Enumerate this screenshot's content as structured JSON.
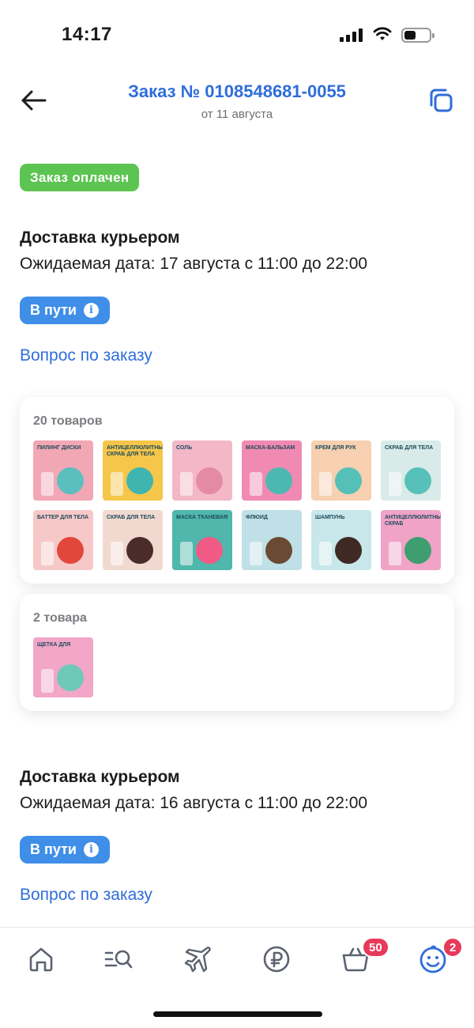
{
  "status_bar": {
    "time": "14:17",
    "battery_level": 0.45
  },
  "header": {
    "title": "Заказ № 0108548681-0055",
    "subtitle": "от 11 августа"
  },
  "order_status": "Заказ оплачен",
  "shipments": [
    {
      "title": "Доставка курьером",
      "expected": "Ожидаемая дата: 17 августа с 11:00 до 22:00",
      "status": "В пути",
      "question": "Вопрос по заказу"
    },
    {
      "title": "Доставка курьером",
      "expected": "Ожидаемая дата: 16 августа с 11:00 до 22:00",
      "status": "В пути",
      "question": "Вопрос по заказу"
    }
  ],
  "groups": [
    {
      "count": "20 товаров",
      "items": [
        {
          "label": "Пилинг диски",
          "bg": "#f2a7b5",
          "accent": "#5bbfbf"
        },
        {
          "label": "Антицеллюлитный скраб для тела",
          "bg": "#f5c64a",
          "accent": "#3fb5b0"
        },
        {
          "label": "Соль",
          "bg": "#f3b7c8",
          "accent": "#e58aa5"
        },
        {
          "label": "Маска-бальзам",
          "bg": "#f08ab3",
          "accent": "#4db8b2"
        },
        {
          "label": "Крем для рук",
          "bg": "#f6d0b0",
          "accent": "#55c0b7"
        },
        {
          "label": "Скраб для тела",
          "bg": "#d8ebe8",
          "accent": "#57c1b9"
        },
        {
          "label": "Баттер для тела",
          "bg": "#f7c8c8",
          "accent": "#e2473b"
        },
        {
          "label": "Скраб для тела",
          "bg": "#f1d9cf",
          "accent": "#4a2d2a"
        },
        {
          "label": "Маска тканевая",
          "bg": "#4fb7ac",
          "accent": "#f05b86"
        },
        {
          "label": "Флюид",
          "bg": "#bfe0e6",
          "accent": "#6b4a34"
        },
        {
          "label": "Шампунь",
          "bg": "#c7e7ea",
          "accent": "#3e2a22"
        },
        {
          "label": "Антицеллюлитный скраб",
          "bg": "#f0a3c7",
          "accent": "#3e9e6f"
        }
      ]
    },
    {
      "count": "2 товара",
      "items": [
        {
          "label": "Щетка для",
          "bg": "#f2a6c8",
          "accent": "#6fc9b9"
        }
      ]
    }
  ],
  "nav": {
    "cart_count": "50",
    "profile_count": "2"
  },
  "colors": {
    "accent_blue": "#2f6ddb",
    "paid_green": "#5cc451",
    "transit_blue": "#3f8ee8",
    "badge_red": "#e73a5a"
  }
}
